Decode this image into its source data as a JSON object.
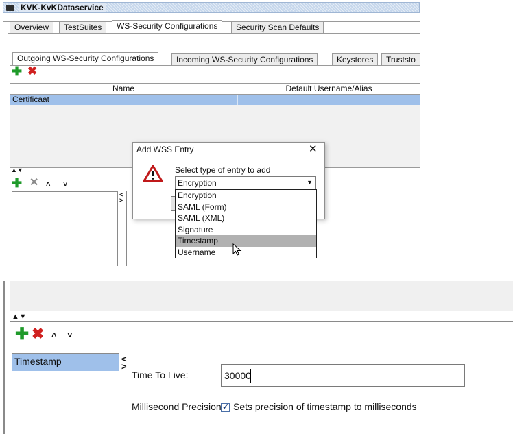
{
  "window": {
    "title": "KVK-KvKDataservice"
  },
  "main_tabs": [
    "Overview",
    "TestSuites",
    "WS-Security Configurations",
    "Security Scan Defaults"
  ],
  "sub_tabs": [
    "Outgoing WS-Security Configurations",
    "Incoming WS-Security Configurations",
    "Keystores",
    "Truststo"
  ],
  "table": {
    "columns": [
      "Name",
      "Default Username/Alias"
    ],
    "rows": [
      {
        "name": "Certificaat",
        "alias": ""
      }
    ]
  },
  "dialog": {
    "title": "Add WSS Entry",
    "prompt": "Select type of entry to add",
    "selected": "Encryption",
    "options": [
      "Encryption",
      "SAML (Form)",
      "SAML (XML)",
      "Signature",
      "Timestamp",
      "Username"
    ],
    "highlighted_index": 4
  },
  "bottom": {
    "entries": [
      "Timestamp"
    ],
    "fields": {
      "ttl_label": "Time To Live:",
      "ttl_value": "30000",
      "ms_label": "Millisecond Precision:",
      "ms_checkbox_label": "Sets precision of timestamp to milliseconds",
      "ms_checked": true
    }
  },
  "colors": {
    "accent": "#9fc0ea",
    "add": "#1f9a2a",
    "remove": "#d0201f"
  }
}
